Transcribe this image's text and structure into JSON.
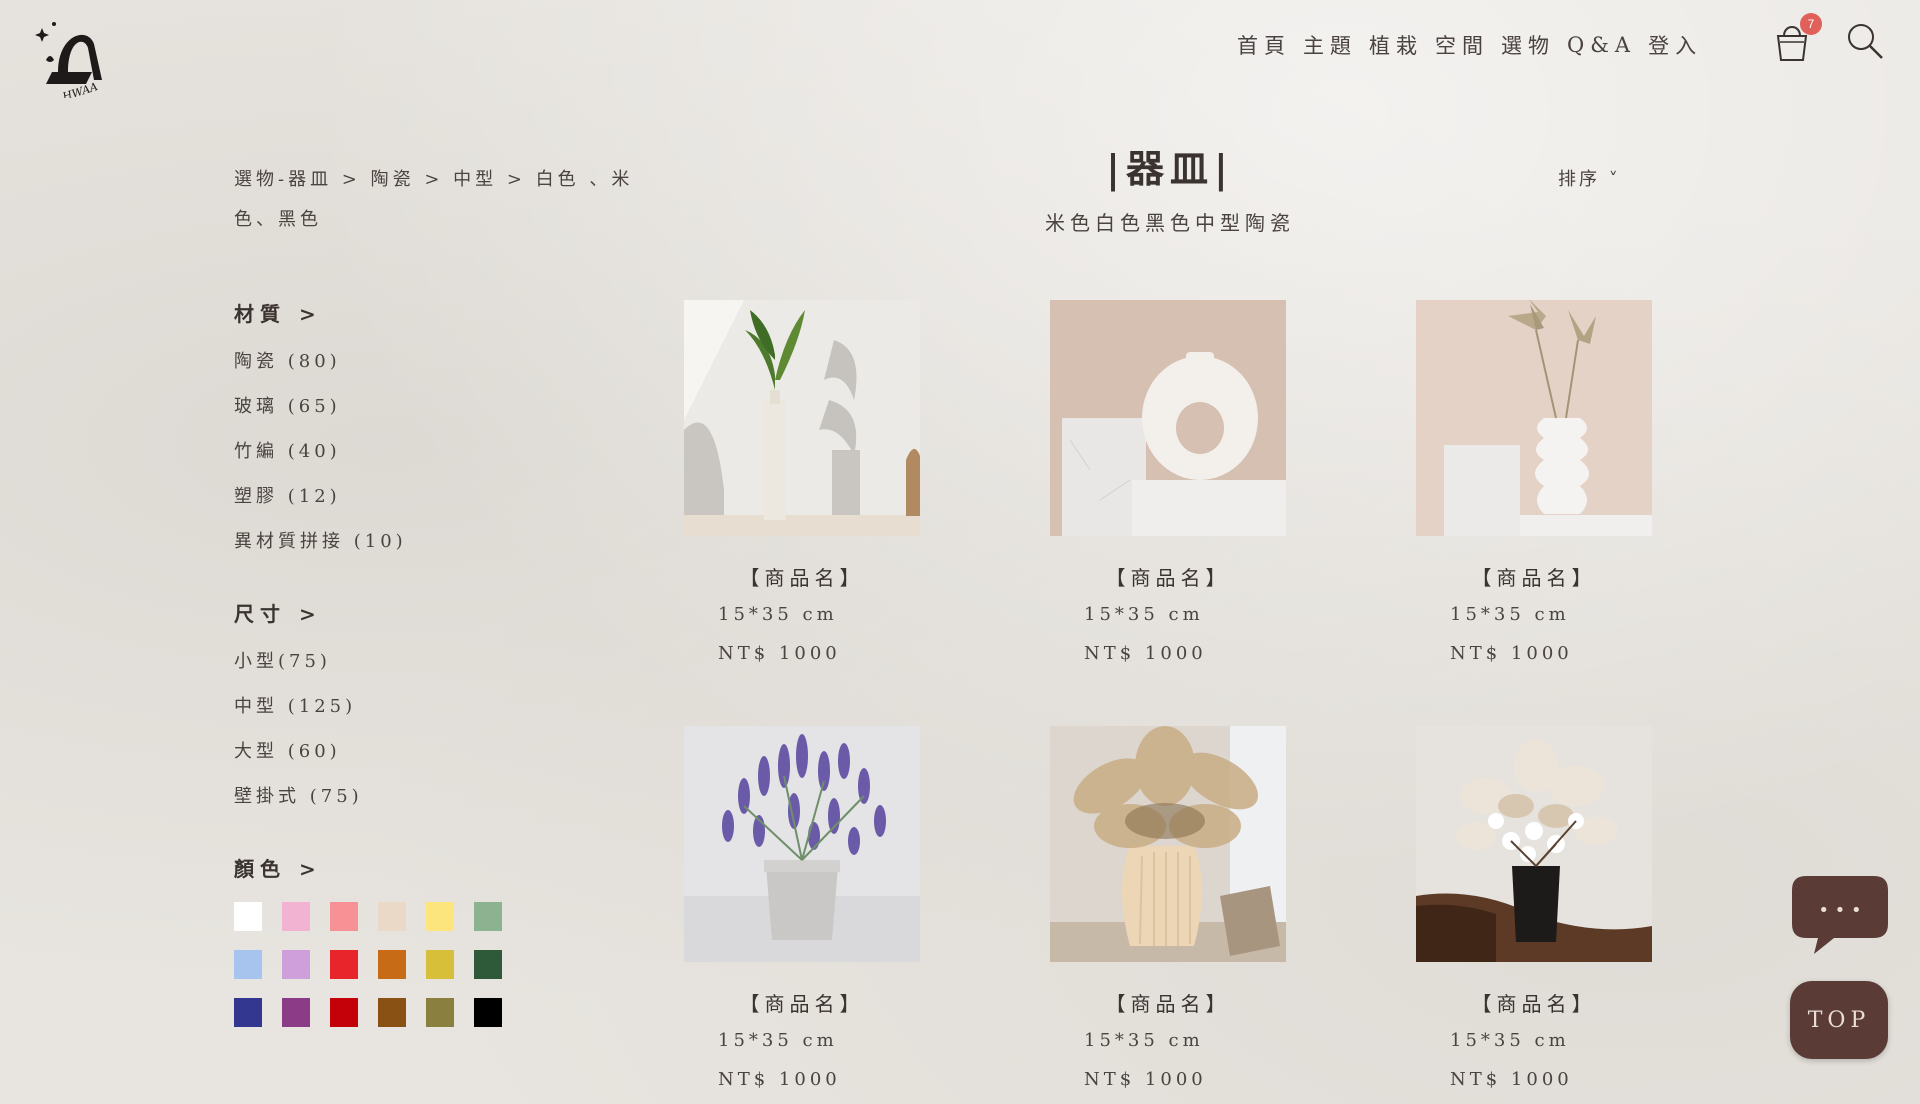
{
  "brand": {
    "logo_text": "HWAA"
  },
  "nav": {
    "items": [
      "首頁",
      "主題",
      "植栽",
      "空間",
      "選物",
      "Q&A",
      "登入"
    ],
    "cart_count": "7"
  },
  "breadcrumb": {
    "text": "選物-器皿 > 陶瓷 > 中型 > 白色 、米色、黑色"
  },
  "heading": {
    "title": "|器皿|",
    "subtitle": "米色白色黑色中型陶瓷"
  },
  "sort": {
    "label": "排序 ˅"
  },
  "filters": {
    "material": {
      "title": "材質 >",
      "items": [
        "陶瓷 (80)",
        "玻璃 (65)",
        "竹編 (40)",
        "塑膠 (12)",
        "異材質拼接 (10)"
      ]
    },
    "size": {
      "title": "尺寸 >",
      "items": [
        "小型(75)",
        "中型 (125)",
        "大型 (60)",
        "壁掛式 (75)"
      ]
    },
    "color": {
      "title": "顏色 >",
      "swatches": [
        "#ffffff",
        "#f2b3d3",
        "#f79196",
        "#ead9c6",
        "#fde57d",
        "#8cb28f",
        "#a7c4ef",
        "#cf9fdc",
        "#e8252a",
        "#c86b16",
        "#d7bf3a",
        "#2e5a3a",
        "#33378f",
        "#8c3c86",
        "#c40008",
        "#8a5114",
        "#8b7f3f",
        "#000000"
      ]
    }
  },
  "products": [
    {
      "name": "【商品名】",
      "size": "15*35 cm",
      "price": "NT$ 1000",
      "image": "white-bottle-vase-with-leaves"
    },
    {
      "name": "【商品名】",
      "size": "15*35 cm",
      "price": "NT$ 1000",
      "image": "donut-ring-vase"
    },
    {
      "name": "【商品名】",
      "size": "15*35 cm",
      "price": "NT$ 1000",
      "image": "wavy-vase-with-palm-leaves"
    },
    {
      "name": "【商品名】",
      "size": "15*35 cm",
      "price": "NT$ 1000",
      "image": "lavender-in-grey-pot"
    },
    {
      "name": "【商品名】",
      "size": "15*35 cm",
      "price": "NT$ 1000",
      "image": "pampas-grass-ribbed-vase"
    },
    {
      "name": "【商品名】",
      "size": "15*35 cm",
      "price": "NT$ 1000",
      "image": "dried-cotton-bouquet-black-vase"
    }
  ],
  "floating": {
    "top_label": "TOP",
    "chat_label": "• • •"
  }
}
